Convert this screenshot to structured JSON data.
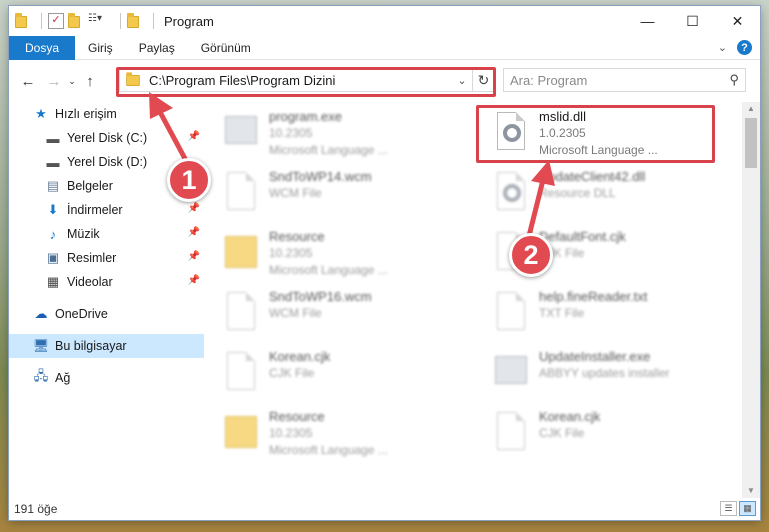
{
  "window": {
    "title": "Program"
  },
  "titlebar": {
    "minimize": "—",
    "maximize": "☐",
    "close": "✕"
  },
  "ribbon": {
    "tabs": [
      "Dosya",
      "Giriş",
      "Paylaş",
      "Görünüm"
    ]
  },
  "address": {
    "path": "C:\\Program Files\\Program Dizini"
  },
  "search": {
    "placeholder": "Ara: Program"
  },
  "sidebar": {
    "items": [
      {
        "label": "Hızlı erişim",
        "icon": "star-icon"
      },
      {
        "label": "Yerel Disk (C:)",
        "icon": "drive-icon",
        "pinned": true
      },
      {
        "label": "Yerel Disk (D:)",
        "icon": "drive-icon"
      },
      {
        "label": "Belgeler",
        "icon": "documents-icon"
      },
      {
        "label": "İndirmeler",
        "icon": "download-icon",
        "pinned": true
      },
      {
        "label": "Müzik",
        "icon": "music-icon",
        "pinned": true
      },
      {
        "label": "Resimler",
        "icon": "pictures-icon",
        "pinned": true
      },
      {
        "label": "Videolar",
        "icon": "videos-icon",
        "pinned": true
      },
      {
        "label": "OneDrive",
        "icon": "cloud-icon"
      },
      {
        "label": "Bu bilgisayar",
        "icon": "computer-icon",
        "selected": true
      },
      {
        "label": "Ağ",
        "icon": "network-icon"
      }
    ]
  },
  "files": [
    {
      "name": "program.exe",
      "line2": "10.2305",
      "line3": "Microsoft Language ...",
      "icon": "app"
    },
    {
      "name": "mslid.dll",
      "line2": "1.0.2305",
      "line3": "Microsoft Language ...",
      "icon": "gear"
    },
    {
      "name": "SndToWP14.wcm",
      "line2": "WCM File",
      "line3": "",
      "icon": "page"
    },
    {
      "name": "UpdateClient42.dll",
      "line2": "Resource DLL",
      "line3": "",
      "icon": "gear"
    },
    {
      "name": "Resource",
      "line2": "10.2305",
      "line3": "Microsoft Language ...",
      "icon": "folder"
    },
    {
      "name": "DefaultFont.cjk",
      "line2": "CJK File",
      "line3": "",
      "icon": "page"
    },
    {
      "name": "SndToWP16.wcm",
      "line2": "WCM File",
      "line3": "",
      "icon": "page"
    },
    {
      "name": "help.fineReader.txt",
      "line2": "TXT File",
      "line3": "",
      "icon": "page"
    },
    {
      "name": "Korean.cjk",
      "line2": "CJK File",
      "line3": "",
      "icon": "page"
    },
    {
      "name": "UpdateInstaller.exe",
      "line2": "ABBYY updates installer",
      "line3": "",
      "icon": "app"
    },
    {
      "name": "Resource",
      "line2": "10.2305",
      "line3": "Microsoft Language ...",
      "icon": "folder"
    },
    {
      "name": "Korean.cjk",
      "line2": "CJK File",
      "line3": "",
      "icon": "page"
    }
  ],
  "status": {
    "count": "191 öğe"
  },
  "annotations": {
    "badge1": "1",
    "badge2": "2"
  },
  "colors": {
    "accent": "#1979ca",
    "highlight": "#d8424a",
    "selected": "#cce8ff"
  }
}
